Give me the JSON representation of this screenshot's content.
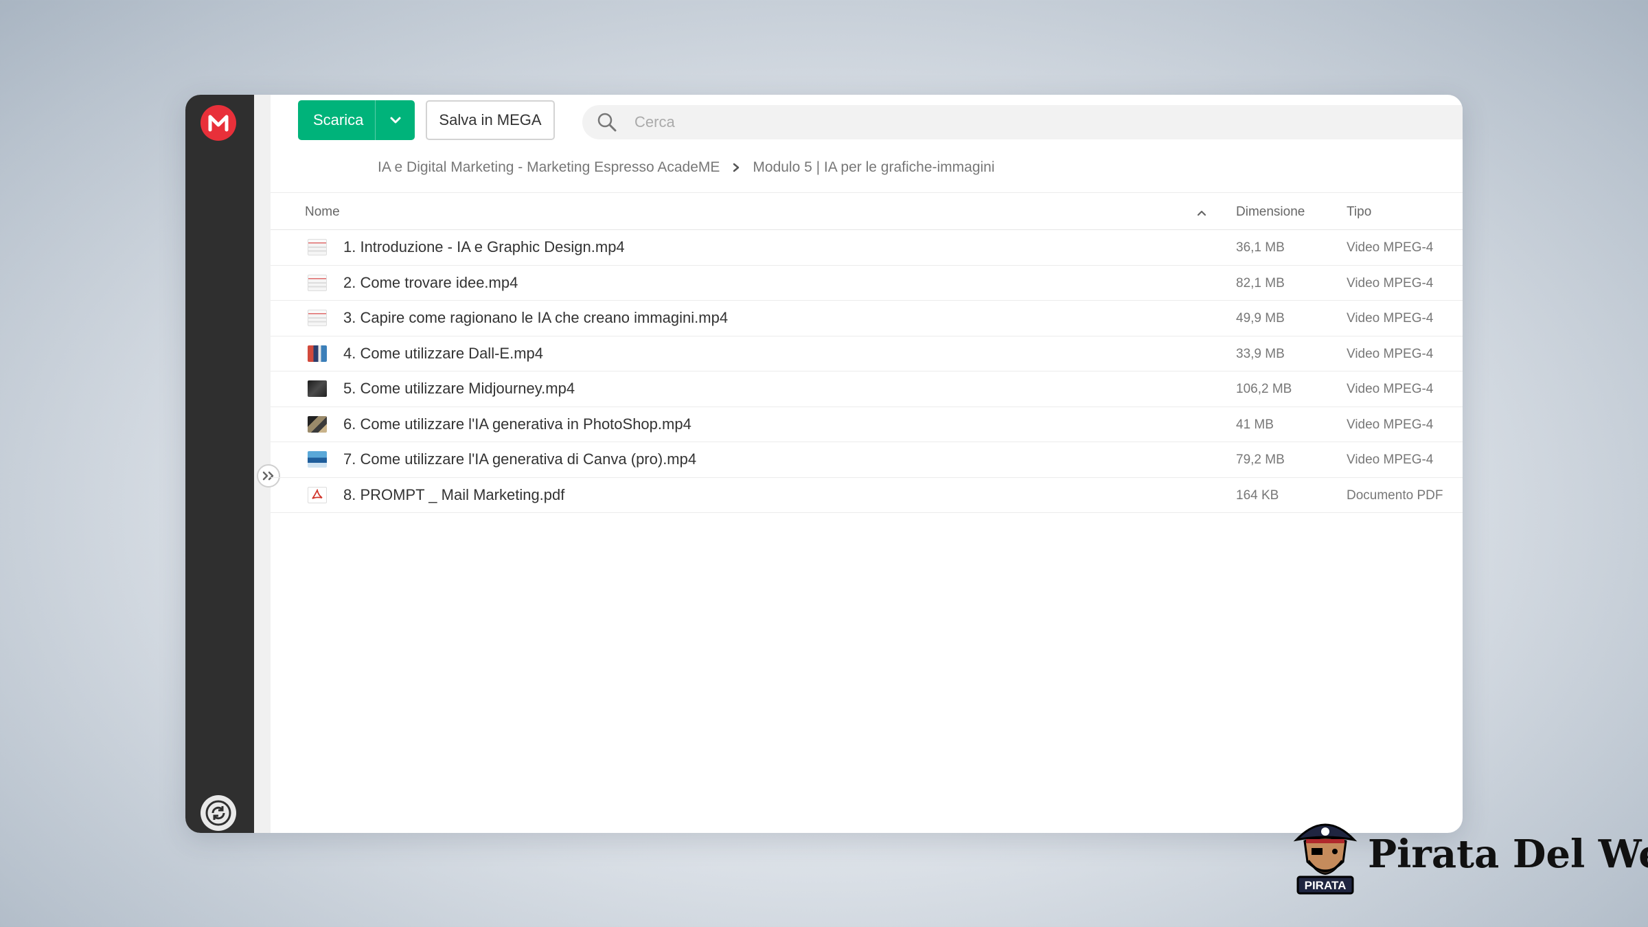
{
  "toolbar": {
    "download_label": "Scarica",
    "save_label": "Salva in MEGA"
  },
  "search": {
    "placeholder": "Cerca"
  },
  "breadcrumb": {
    "parent": "IA e Digital Marketing - Marketing Espresso AcadeME",
    "current": "Modulo 5 | IA per le grafiche-immagini"
  },
  "table": {
    "headers": {
      "name": "Nome",
      "size": "Dimensione",
      "type": "Tipo"
    },
    "rows": [
      {
        "name": "1. Introduzione - IA e Graphic Design.mp4",
        "size": "36,1 MB",
        "type": "Video MPEG-4",
        "thumb": "slide"
      },
      {
        "name": "2. Come trovare idee.mp4",
        "size": "82,1 MB",
        "type": "Video MPEG-4",
        "thumb": "slide"
      },
      {
        "name": "3. Capire come ragionano le IA che creano immagini.mp4",
        "size": "49,9 MB",
        "type": "Video MPEG-4",
        "thumb": "slide"
      },
      {
        "name": "4. Come utilizzare Dall-E.mp4",
        "size": "33,9 MB",
        "type": "Video MPEG-4",
        "thumb": "dalle"
      },
      {
        "name": "5. Come utilizzare Midjourney.mp4",
        "size": "106,2 MB",
        "type": "Video MPEG-4",
        "thumb": "dark"
      },
      {
        "name": "6. Come utilizzare l'IA generativa in PhotoShop.mp4",
        "size": "41 MB",
        "type": "Video MPEG-4",
        "thumb": "photo"
      },
      {
        "name": "7. Come utilizzare l'IA generativa di Canva (pro).mp4",
        "size": "79,2 MB",
        "type": "Video MPEG-4",
        "thumb": "canva"
      },
      {
        "name": "8. PROMPT _ Mail Marketing.pdf",
        "size": "164 KB",
        "type": "Documento PDF",
        "thumb": "pdf"
      }
    ]
  },
  "watermark": {
    "brand_name": "Pirata Del Web",
    "badge": "PIRATA"
  },
  "colors": {
    "accent": "#00b37a",
    "mega_red": "#e8303a",
    "sidebar": "#2f2f2f"
  }
}
